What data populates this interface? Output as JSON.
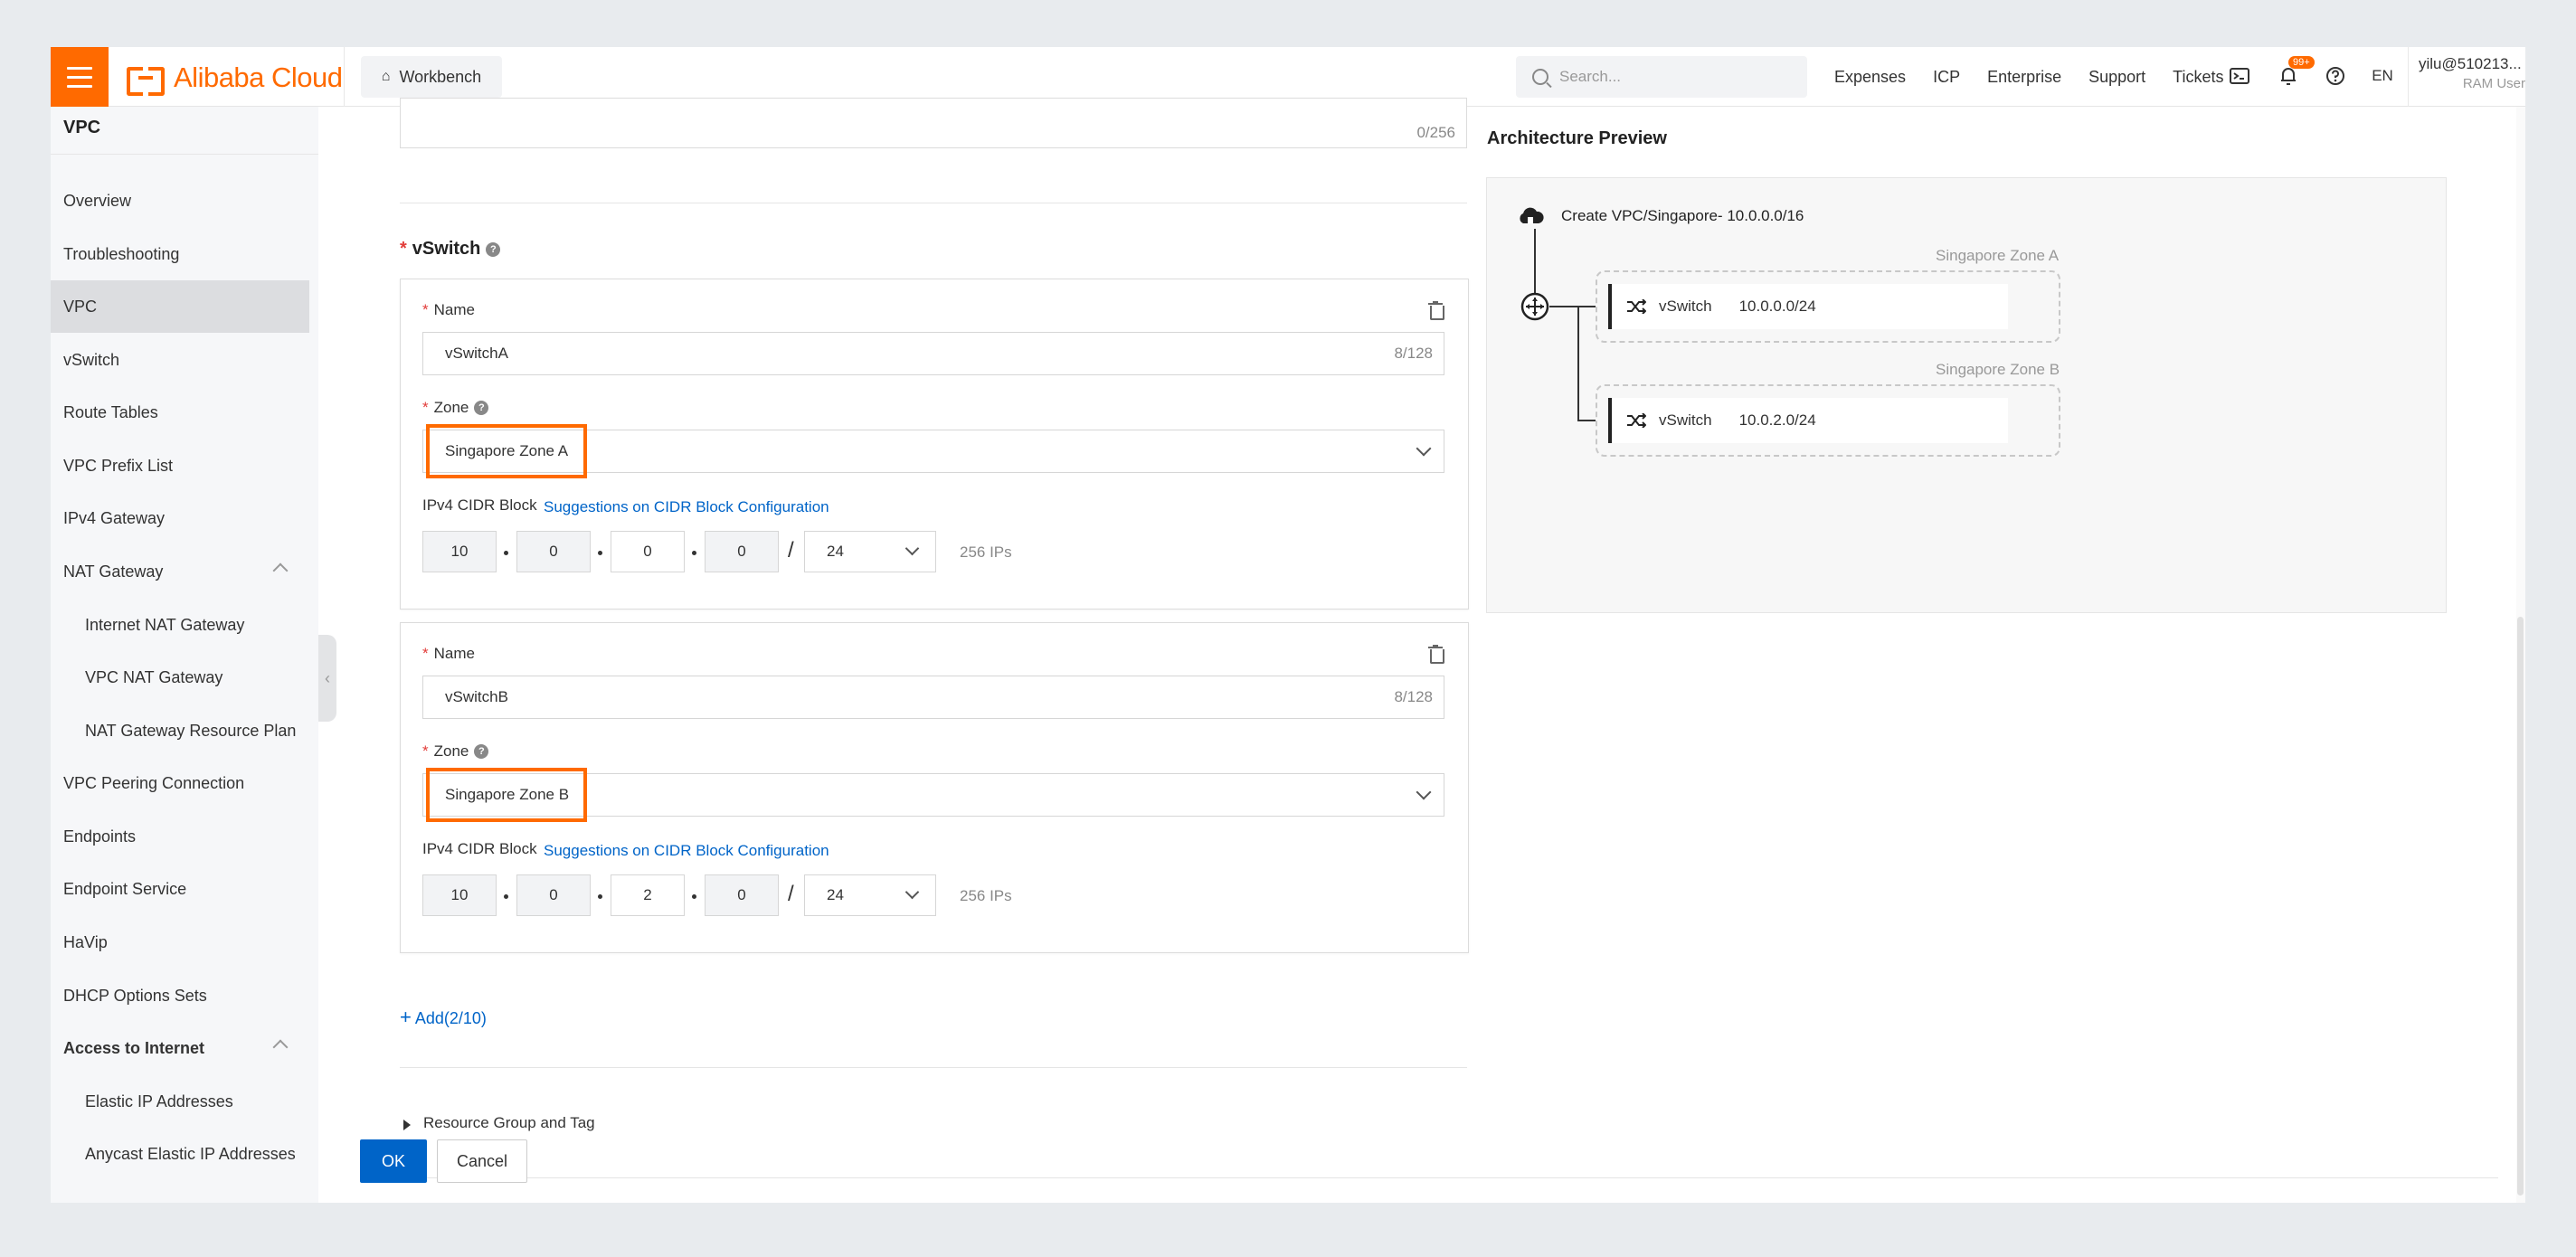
{
  "topbar": {
    "brand": "Alibaba Cloud",
    "workbench": "Workbench",
    "search_placeholder": "Search...",
    "links": [
      "Expenses",
      "ICP",
      "Enterprise",
      "Support",
      "Tickets"
    ],
    "notification_badge": "99+",
    "language": "EN",
    "user_name": "yilu@510213...",
    "user_role": "RAM User"
  },
  "sidebar": {
    "title": "VPC",
    "items": [
      {
        "label": "Overview"
      },
      {
        "label": "Troubleshooting"
      },
      {
        "label": "VPC",
        "active": true
      },
      {
        "label": "vSwitch"
      },
      {
        "label": "Route Tables"
      },
      {
        "label": "VPC Prefix List"
      },
      {
        "label": "IPv4 Gateway"
      },
      {
        "label": "NAT Gateway",
        "expanded": true
      },
      {
        "label": "Internet NAT Gateway",
        "sub": true
      },
      {
        "label": "VPC NAT Gateway",
        "sub": true
      },
      {
        "label": "NAT Gateway Resource Plan",
        "sub": true
      },
      {
        "label": "VPC Peering Connection"
      },
      {
        "label": "Endpoints"
      },
      {
        "label": "Endpoint Service"
      },
      {
        "label": "HaVip"
      },
      {
        "label": "DHCP Options Sets"
      },
      {
        "label": "Access to Internet",
        "group": true,
        "expanded": true
      },
      {
        "label": "Elastic IP Addresses",
        "sub": true
      },
      {
        "label": "Anycast Elastic IP Addresses",
        "sub": true
      }
    ]
  },
  "form": {
    "description_counter": "0/256",
    "vswitch_title": "vSwitch",
    "vswitches": [
      {
        "name_label": "Name",
        "name_value": "vSwitchA",
        "name_counter": "8/128",
        "zone_label": "Zone",
        "zone_value": "Singapore Zone A",
        "cidr_label": "IPv4 CIDR Block",
        "cidr_link": "Suggestions on CIDR Block Configuration",
        "octets": [
          "10",
          "0",
          "0",
          "0"
        ],
        "mask": "24",
        "ips": "256 IPs"
      },
      {
        "name_label": "Name",
        "name_value": "vSwitchB",
        "name_counter": "8/128",
        "zone_label": "Zone",
        "zone_value": "Singapore Zone B",
        "cidr_label": "IPv4 CIDR Block",
        "cidr_link": "Suggestions on CIDR Block Configuration",
        "octets": [
          "10",
          "0",
          "2",
          "0"
        ],
        "mask": "24",
        "ips": "256 IPs"
      }
    ],
    "add_label": "Add(2/10)",
    "resource_group": "Resource Group and Tag",
    "ok": "OK",
    "cancel": "Cancel"
  },
  "architecture": {
    "title": "Architecture Preview",
    "vpc_label": "Create VPC/Singapore- 10.0.0.0/16",
    "zones": [
      {
        "label": "Singapore Zone A",
        "vswitch": "vSwitch",
        "cidr": "10.0.0.0/24"
      },
      {
        "label": "Singapore Zone B",
        "vswitch": "vSwitch",
        "cidr": "10.0.2.0/24"
      }
    ]
  }
}
